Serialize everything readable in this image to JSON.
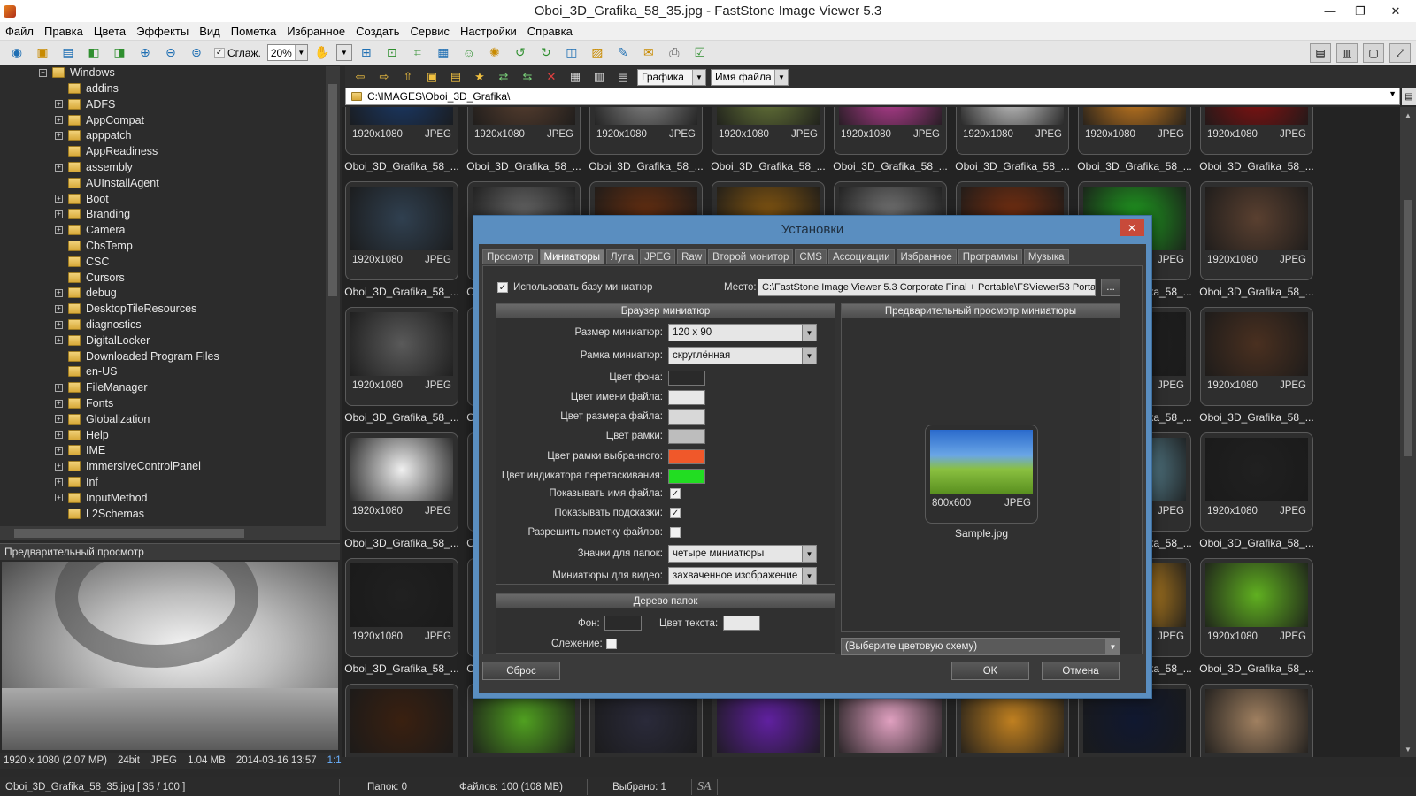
{
  "window": {
    "title": "Oboi_3D_Grafika_58_35.jpg  -  FastStone Image Viewer 5.3"
  },
  "menu": [
    "Файл",
    "Правка",
    "Цвета",
    "Эффекты",
    "Вид",
    "Пометка",
    "Избранное",
    "Создать",
    "Сервис",
    "Настройки",
    "Справка"
  ],
  "toolbar": {
    "smooth_label": "Сглаж.",
    "zoom_value": "20%"
  },
  "tree": {
    "root": "Windows",
    "items": [
      {
        "label": "addins",
        "exp": false
      },
      {
        "label": "ADFS",
        "exp": true
      },
      {
        "label": "AppCompat",
        "exp": true
      },
      {
        "label": "apppatch",
        "exp": true
      },
      {
        "label": "AppReadiness",
        "exp": false
      },
      {
        "label": "assembly",
        "exp": true
      },
      {
        "label": "AUInstallAgent",
        "exp": false
      },
      {
        "label": "Boot",
        "exp": true
      },
      {
        "label": "Branding",
        "exp": true
      },
      {
        "label": "Camera",
        "exp": true
      },
      {
        "label": "CbsTemp",
        "exp": false
      },
      {
        "label": "CSC",
        "exp": false
      },
      {
        "label": "Cursors",
        "exp": false
      },
      {
        "label": "debug",
        "exp": true
      },
      {
        "label": "DesktopTileResources",
        "exp": true
      },
      {
        "label": "diagnostics",
        "exp": true
      },
      {
        "label": "DigitalLocker",
        "exp": true
      },
      {
        "label": "Downloaded Program Files",
        "exp": false
      },
      {
        "label": "en-US",
        "exp": false
      },
      {
        "label": "FileManager",
        "exp": true
      },
      {
        "label": "Fonts",
        "exp": true
      },
      {
        "label": "Globalization",
        "exp": true
      },
      {
        "label": "Help",
        "exp": true
      },
      {
        "label": "IME",
        "exp": true
      },
      {
        "label": "ImmersiveControlPanel",
        "exp": true
      },
      {
        "label": "Inf",
        "exp": true
      },
      {
        "label": "InputMethod",
        "exp": true
      },
      {
        "label": "L2Schemas",
        "exp": false
      }
    ]
  },
  "preview": {
    "header": "Предварительный просмотр",
    "info": [
      "1920 x 1080 (2.07 MP)",
      "24bit",
      "JPEG",
      "1.04 MB",
      "2014-03-16 13:57",
      "1:1"
    ]
  },
  "browser": {
    "filter_value": "Графика",
    "sort_value": "Имя файла",
    "path": "C:\\IMAGES\\Oboi_3D_Grafika\\"
  },
  "thumbs": {
    "dim": "1920x1080",
    "fmt": "JPEG",
    "name": "Oboi_3D_Grafika_58_...",
    "row_colors": [
      [
        "#1a3a6a",
        "#5a4030",
        "#8a8a8a",
        "#6a7a3a",
        "#c0409a",
        "#d0d0d0",
        "#d08020",
        "#8a1010"
      ],
      [
        "#304050",
        "#6a6a6a",
        "#6a3010",
        "#8a5a10",
        "#7a7a7a",
        "#7a3010",
        "#20a020",
        "#5a4030"
      ],
      [
        "#5a5a5a",
        "#000000",
        "#000000",
        "#000000",
        "#000000",
        "#000000",
        "#202020",
        "#4a3020"
      ],
      [
        "#f0f0f0",
        "#000000",
        "#000000",
        "#000000",
        "#000000",
        "#000000",
        "#6090a0",
        "#202020"
      ],
      [
        "#202020",
        "#000000",
        "#000000",
        "#000000",
        "#000000",
        "#000000",
        "#d09020",
        "#60b020"
      ],
      [
        "#3a2010",
        "#50a020",
        "#2a2a3a",
        "#6020a0",
        "#e0a0c0",
        "#c08020",
        "#101830",
        "#a08060"
      ]
    ]
  },
  "status": {
    "file": "Oboi_3D_Grafika_58_35.jpg [ 35 / 100 ]",
    "folders": "Папок: 0",
    "files": "Файлов: 100 (108 MB)",
    "selected": "Выбрано: 1",
    "sa": "SA"
  },
  "dialog": {
    "title": "Установки",
    "close": "✕",
    "tabs": [
      "Просмотр",
      "Миниатюры",
      "Лупа",
      "JPEG",
      "Raw",
      "Второй монитор",
      "CMS",
      "Ассоциации",
      "Избранное",
      "Программы",
      "Музыка"
    ],
    "active_tab": 1,
    "use_db_label": "Использовать базу миниатюр",
    "location_label": "Место:",
    "location_value": "C:\\FastStone Image Viewer 5.3 Corporate Final + Portable\\FSViewer53 Portable\\",
    "browse": "...",
    "browser_group": "Браузер миниатюр",
    "size_label": "Размер миниатюр:",
    "size_value": "120 x 90",
    "frame_label": "Рамка миниатюр:",
    "frame_value": "скруглённая",
    "bg_color_label": "Цвет фона:",
    "name_color_label": "Цвет имени файла:",
    "filesize_color_label": "Цвет размера файла:",
    "frame_color_label": "Цвет рамки:",
    "sel_frame_color_label": "Цвет рамки выбранного:",
    "drag_color_label": "Цвет индикатора перетаскивания:",
    "show_name_label": "Показывать имя файла:",
    "show_hints_label": "Показывать подсказки:",
    "allow_mark_label": "Разрешить пометку файлов:",
    "folder_icons_label": "Значки для папок:",
    "folder_icons_value": "четыре миниатюры",
    "video_label": "Миниатюры для видео:",
    "video_value": "захваченное изображение",
    "tree_group": "Дерево папок",
    "tree_bg_label": "Фон:",
    "tree_text_label": "Цвет текста:",
    "tracking_label": "Слежение:",
    "preview_group": "Предварительный просмотр миниатюры",
    "sample_dim": "800x600",
    "sample_fmt": "JPEG",
    "sample_name": "Sample.jpg",
    "scheme_value": "(Выберите цветовую схему)",
    "reset": "Сброс",
    "ok": "OK",
    "cancel": "Отмена",
    "colors": {
      "bg": "#2a2a2a",
      "name": "#e8e8e8",
      "size": "#d8d8d8",
      "frame": "#bdbdbd",
      "selected": "#f0582a",
      "drag": "#22dd22",
      "tree_bg": "#2a2a2a",
      "tree_text": "#e8e8e8"
    }
  }
}
